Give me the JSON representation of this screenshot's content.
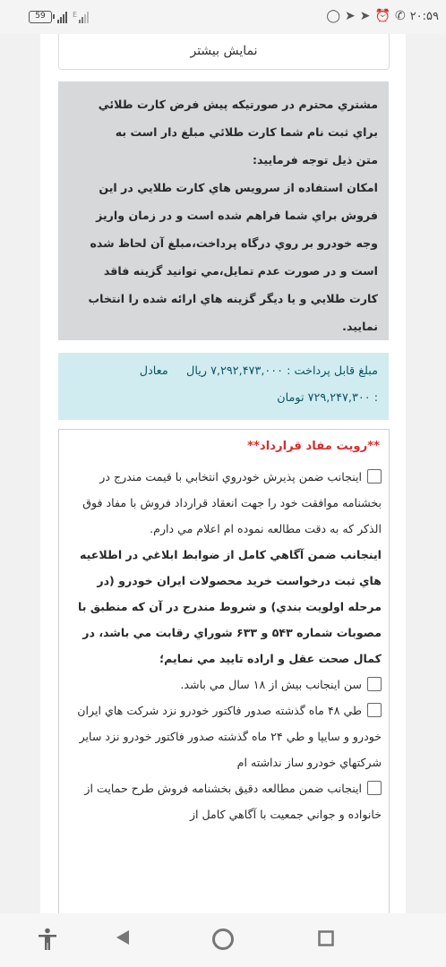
{
  "status_bar": {
    "time": "۲۰:۵۹",
    "battery": "59",
    "signal_small_label": "E",
    "icons": [
      "whatsapp-icon",
      "telegram-icon",
      "telegram-icon",
      "alarm-icon",
      "no-call-icon"
    ]
  },
  "show_more_label": "نمایش بیشتر",
  "notice": {
    "lines": [
      "مشتري محترم در صورتيکه پيش فرض کارت طلائي",
      "براي ثبت نام شما کارت طلائي مبلغ دار است به",
      "متن ذيل توجه فرماييد:",
      "امکان استفاده از سرويس هاي کارت طلايي در اين",
      "فروش براي شما فراهم شده است و در زمان واريز",
      "وجه خودرو بر روي درگاه پرداخت،مبلغ آن لحاظ شده",
      "است و در صورت عدم تمايل،مي توانيد گزينه فاقد",
      "کارت طلايي و يا ديگر گزينه هاي ارائه شده را انتخاب",
      "نماييد."
    ]
  },
  "payment": {
    "label": "مبلغ قابل پرداخت :",
    "amount_rial": "۷,۲۹۲,۴۷۳,۰۰۰",
    "rial_label": "ريال",
    "equiv_label": "معادل",
    "line2_prefix": ":",
    "amount_toman": "۷۲۹,۲۴۷,۳۰۰",
    "toman_label": "تومان"
  },
  "contract": {
    "heading": "**رويت مفاد قرارداد**",
    "checkbox1_text": "اينجانب ضمن پذيرش خودروي انتخابي با قيمت مندرج در بخشنامه موافقت خود را جهت انعقاد قرارداد فروش با مفاد فوق الذکر که به دقت مطالعه نموده ام اعلام مي دارم.",
    "bold_statement": "اينجانب ضمن آگاهي کامل از ضوابط ابلاغي در اطلاعيه هاي ثبت درخواست خريد محصولات ايران خودرو (در مرحله اولويت بندي) و شروط مندرج در آن که منطبق با مصوبات شماره ۵۴۳ و ۶۳۳ شوراي رقابت مي باشد، در کمال صحت عقل و اراده تاييد مي نمايم؛",
    "checkbox2_text": "سن اينجانب بيش از ۱۸ سال مي باشد.",
    "checkbox3_text": "طي ۴۸ ماه گذشته صدور فاکتور خودرو نزد شرکت هاي ايران خودرو و سايپا و طي ۲۴ ماه گذشته صدور فاکتور خودرو نزد ساير شرکتهاي خودرو ساز نداشته ام",
    "checkbox4_text": "اينجانب ضمن مطالعه دقيق بخشنامه فروش طرح حمايت از خانواده و جواني جمعيت با آگاهي کامل از"
  },
  "nav_bar": {
    "items": [
      "accessibility-icon",
      "back-icon",
      "home-icon",
      "recents-icon"
    ]
  }
}
